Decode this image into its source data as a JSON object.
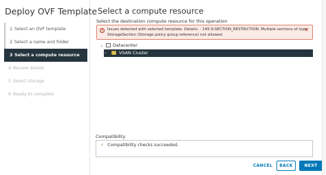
{
  "wizard": {
    "title": "Deploy OVF Template",
    "steps": [
      {
        "num": "1",
        "label": "Select an OVF template",
        "state": "done"
      },
      {
        "num": "2",
        "label": "Select a name and folder",
        "state": "done"
      },
      {
        "num": "3",
        "label": "Select a compute resource",
        "state": "active"
      },
      {
        "num": "4",
        "label": "Review details",
        "state": "pending"
      },
      {
        "num": "5",
        "label": "Select storage",
        "state": "pending"
      },
      {
        "num": "6",
        "label": "Ready to complete",
        "state": "pending"
      }
    ]
  },
  "page": {
    "title": "Select a compute resource",
    "subtitle": "Select the destination compute resource for this operation"
  },
  "alert": {
    "text": "Issues detected with selected template. Details: - 145:9:SECTION_RESTRICTION: Multiple sections of type StorageSection (Storage policy group reference) not allowed.",
    "color": "#e0826e"
  },
  "tree": {
    "datacenter": {
      "label": "Datacenter",
      "icon": "datacenter-icon"
    },
    "cluster": {
      "label": "VSAN Cluster",
      "icon": "cluster-icon"
    }
  },
  "compatibility": {
    "label": "Compatibility",
    "message": "Compatibility checks succeeded."
  },
  "buttons": {
    "cancel": "CANCEL",
    "back": "BACK",
    "next": "NEXT"
  },
  "colors": {
    "accent": "#0079b8",
    "active_step": "#25343d",
    "success": "#4b9b36"
  }
}
